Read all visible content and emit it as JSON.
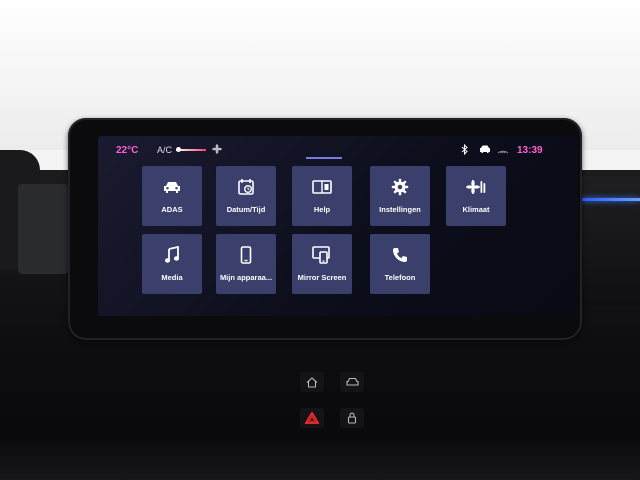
{
  "status_bar": {
    "temperature": "22°C",
    "ac_label": "A/C",
    "time": "13:39",
    "icons": [
      "fan-icon",
      "bluetooth-icon",
      "car-icon",
      "signal-icon"
    ]
  },
  "apps": [
    {
      "label": "ADAS",
      "icon": "car-icon"
    },
    {
      "label": "Datum/Tijd",
      "icon": "calendar-clock-icon"
    },
    {
      "label": "Help",
      "icon": "help-book-icon"
    },
    {
      "label": "Instellingen",
      "icon": "gear-icon"
    },
    {
      "label": "Klimaat",
      "icon": "fan-temperature-icon"
    },
    {
      "label": "Media",
      "icon": "music-note-icon"
    },
    {
      "label": "Mijn apparaa...",
      "icon": "phone-device-icon"
    },
    {
      "label": "Mirror Screen",
      "icon": "mirror-screen-icon"
    },
    {
      "label": "Telefoon",
      "icon": "phone-handset-icon"
    }
  ],
  "hardware_buttons": [
    "home-icon",
    "car-icon",
    "hazard-icon",
    "lock-icon"
  ],
  "colors": {
    "accent": "#ff5fd1",
    "tile": "#3a3f6b",
    "hazard": "#ff2a2a",
    "ambient_blue": "#2a5cff"
  }
}
